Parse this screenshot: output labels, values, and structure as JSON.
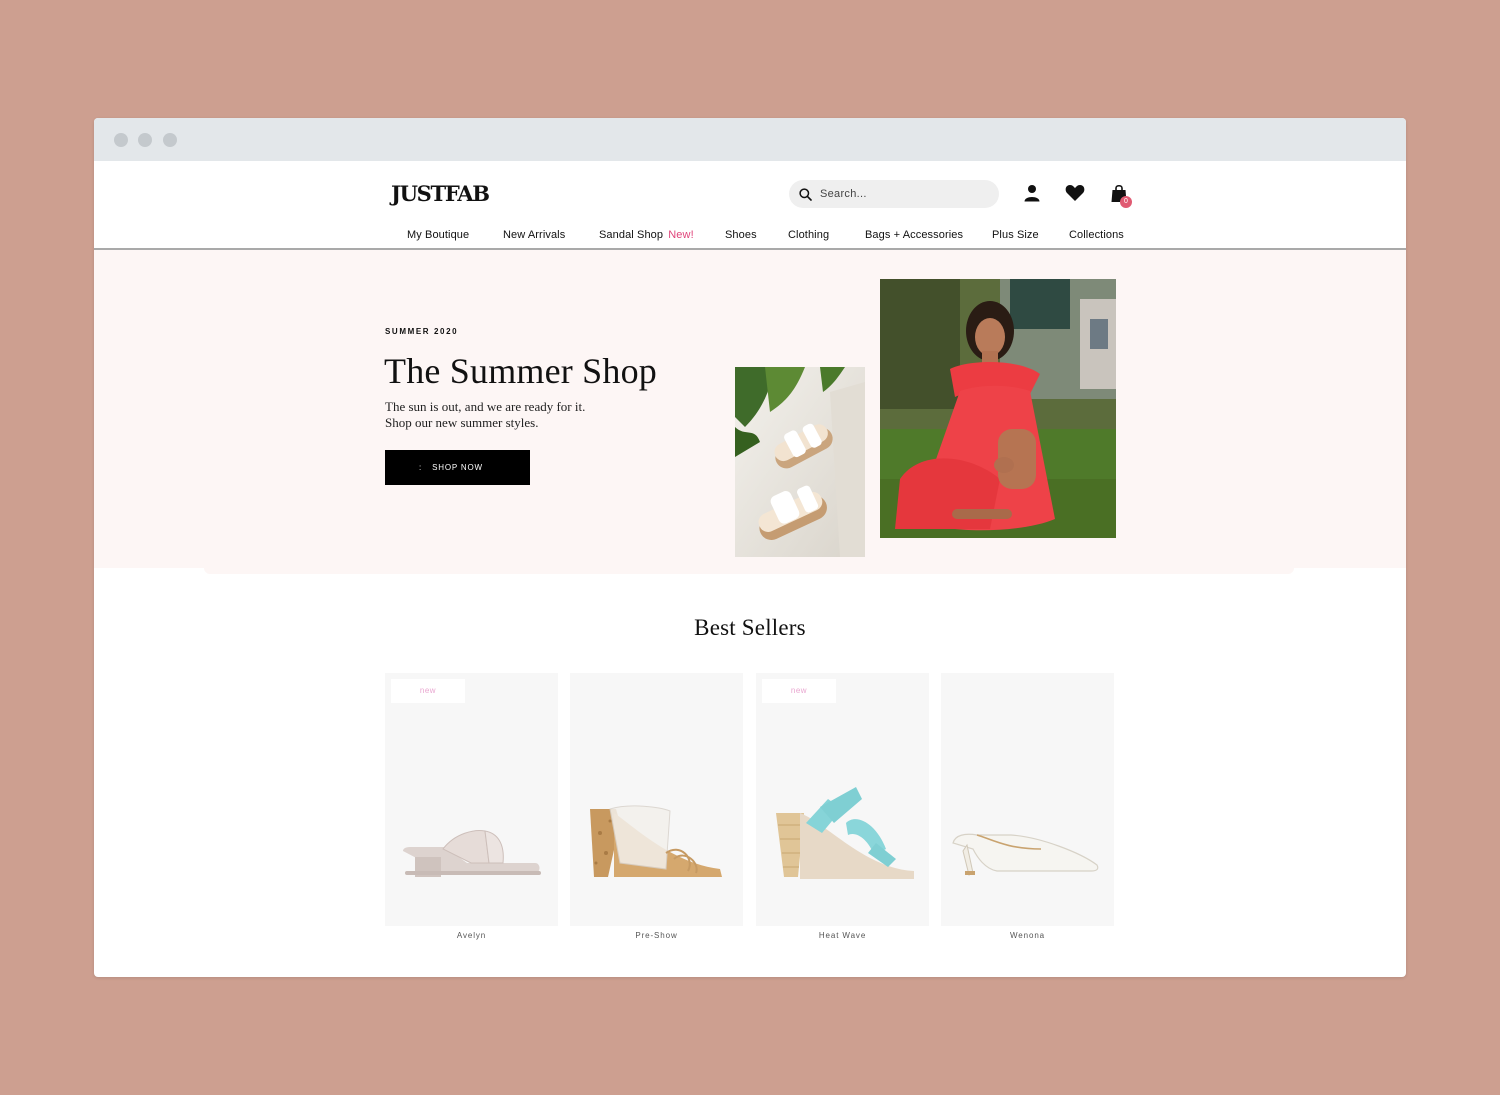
{
  "brand": {
    "logo": "JUSTFAB"
  },
  "search": {
    "placeholder": "Search..."
  },
  "cart": {
    "count": "0"
  },
  "nav": [
    {
      "label": "My Boutique"
    },
    {
      "label": "New Arrivals"
    },
    {
      "label": "Sandal Shop",
      "badge": "New!"
    },
    {
      "label": "Shoes"
    },
    {
      "label": "Clothing"
    },
    {
      "label": "Bags + Accessories"
    },
    {
      "label": "Plus Size"
    },
    {
      "label": "Collections"
    }
  ],
  "hero": {
    "eyebrow": "SUMMER 2020",
    "title": "The Summer Shop",
    "subtitle_line1": "The sun is out, and we are ready for it.",
    "subtitle_line2": "Shop our new summer styles.",
    "cta": "SHOP NOW",
    "cta_prefix": ":"
  },
  "best_sellers": {
    "title": "Best Sellers",
    "products": [
      {
        "name": "Avelyn",
        "tag": "new"
      },
      {
        "name": "Pre-Show",
        "tag": ""
      },
      {
        "name": "Heat Wave",
        "tag": "new"
      },
      {
        "name": "Wenona",
        "tag": ""
      }
    ]
  },
  "colors": {
    "page_background": "#cd9f90",
    "hero_background": "#fdf6f5",
    "new_badge": "#e0457b",
    "cart_badge": "#e05a72",
    "tag_text": "#e9a6d0"
  },
  "icons": [
    "search-icon",
    "account-icon",
    "heart-icon",
    "shopping-bag-icon"
  ]
}
